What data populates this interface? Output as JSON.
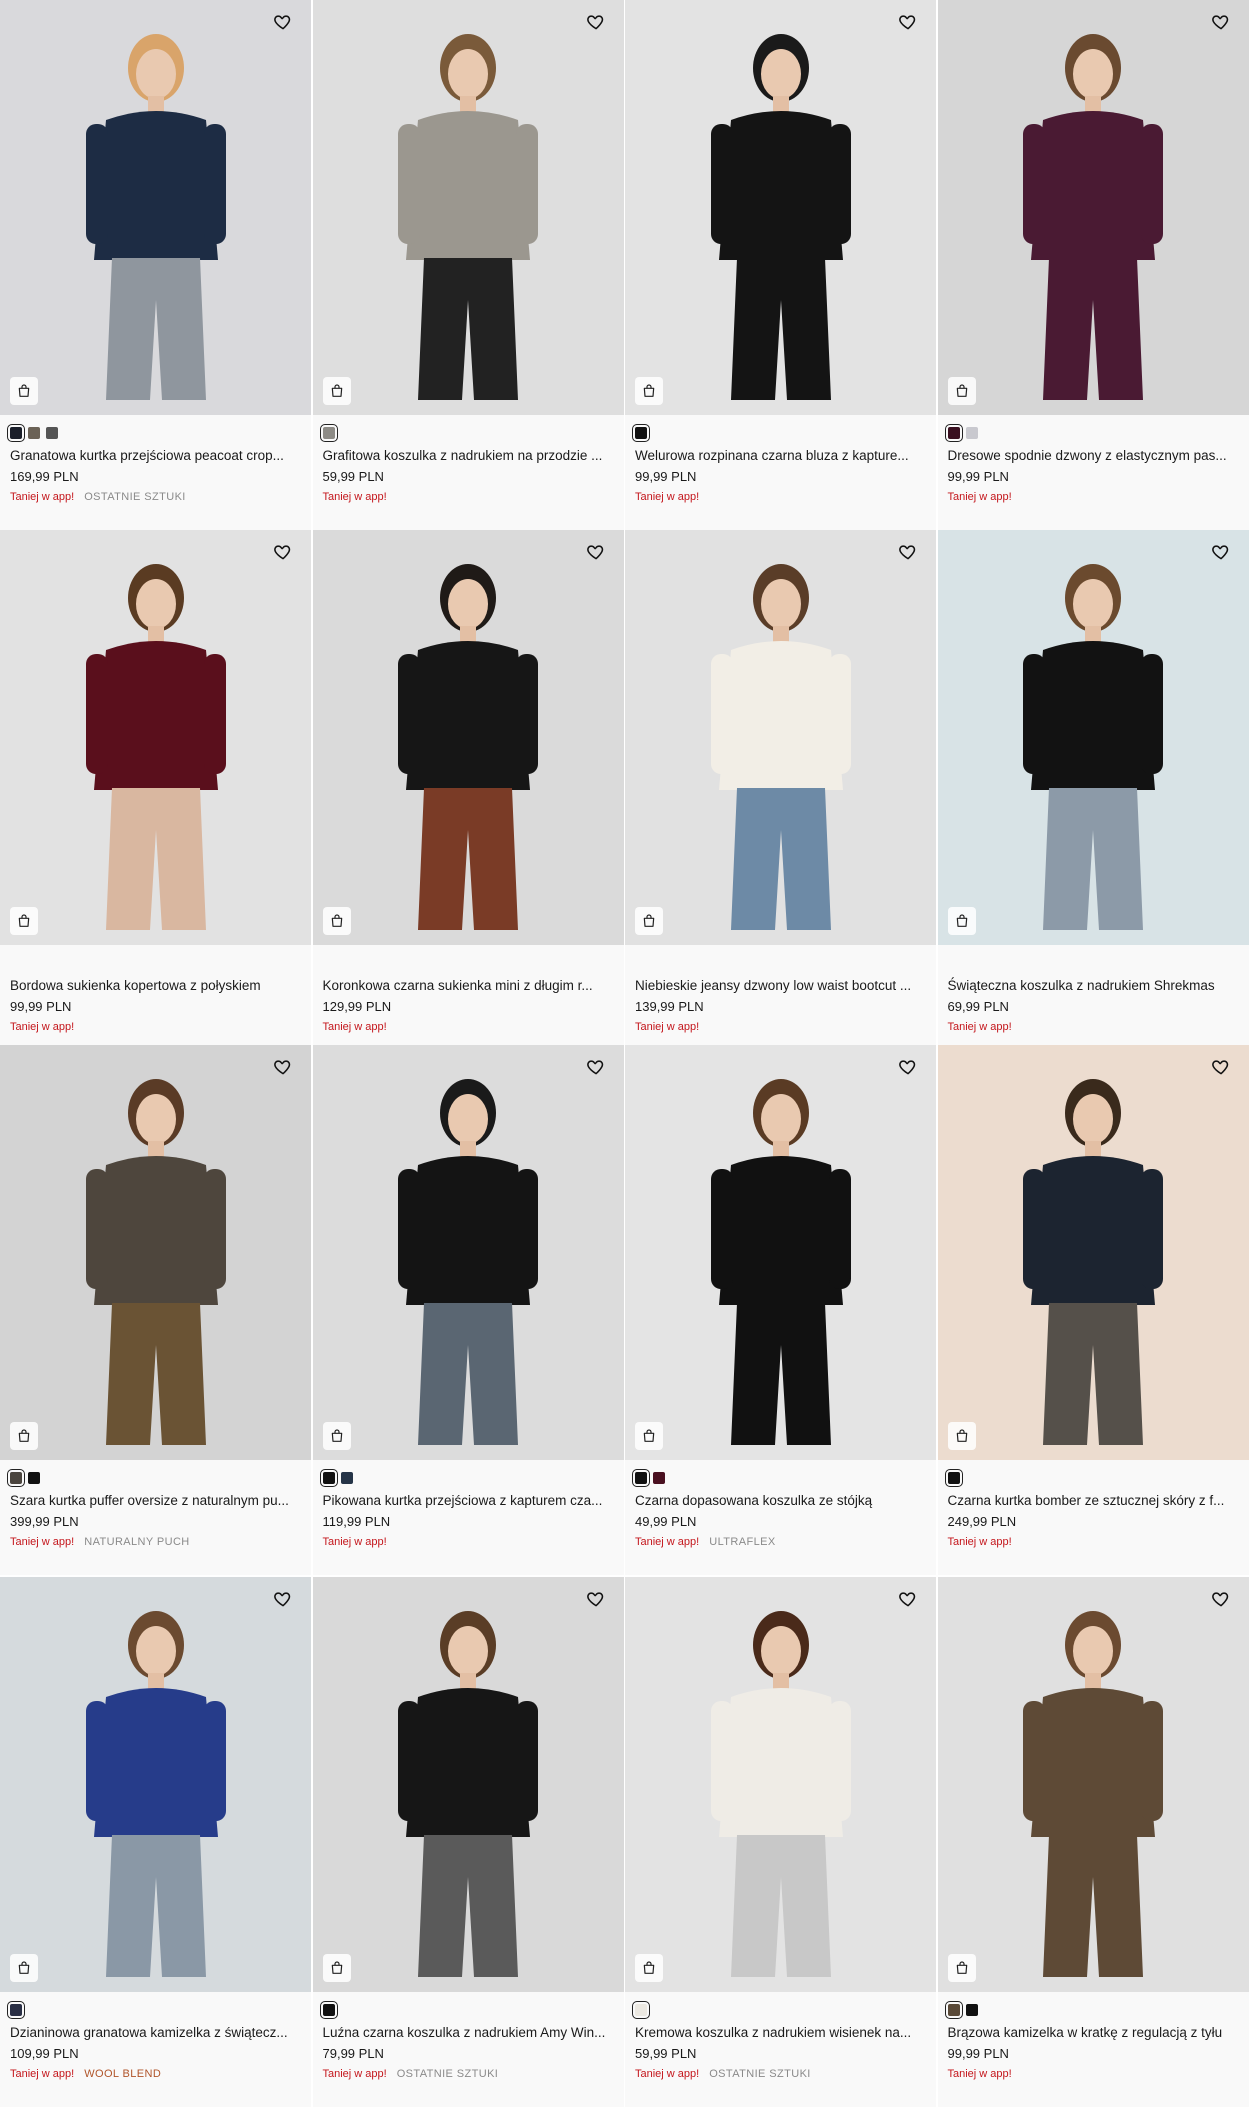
{
  "products": [
    {
      "name": "Granatowa kurtka przejściowa peacoat crop...",
      "price": "169,99 PLN",
      "promo": "Taniej w app!",
      "label": "OSTATNIE SZTUKI",
      "swatches": [
        "#1b1f2a",
        "#6b6256",
        "#555555"
      ],
      "bg": "#d9d9dc",
      "garment": "#1d2c44",
      "bottom": "#8f969e",
      "hair": "#d9a46a"
    },
    {
      "name": "Grafitowa koszulka z nadrukiem na przodzie ...",
      "price": "59,99 PLN",
      "promo": "Taniej w app!",
      "label": "",
      "swatches": [
        "#8d8b86"
      ],
      "bg": "#dedede",
      "garment": "#9b978f",
      "bottom": "#222222",
      "hair": "#7a5a3a"
    },
    {
      "name": "Welurowa rozpinana czarna bluza z kapture...",
      "price": "99,99 PLN",
      "promo": "Taniej w app!",
      "label": "",
      "swatches": [
        "#111111"
      ],
      "bg": "#e3e3e3",
      "garment": "#141414",
      "bottom": "#141414",
      "hair": "#1a1a1a"
    },
    {
      "name": "Dresowe spodnie dzwony z elastycznym pas...",
      "price": "99,99 PLN",
      "promo": "Taniej w app!",
      "label": "",
      "swatches": [
        "#3a1020",
        "#c9c9cf"
      ],
      "bg": "#d6d6d6",
      "garment": "#4a1a33",
      "bottom": "#4a1a33",
      "hair": "#6a4a30"
    },
    {
      "name": "Bordowa sukienka kopertowa z połyskiem",
      "price": "99,99 PLN",
      "promo": "Taniej w app!",
      "label": "",
      "swatches": [],
      "bg": "#e2e2e2",
      "garment": "#5a0f1c",
      "bottom": "#d9b7a0",
      "hair": "#5a3b22"
    },
    {
      "name": "Koronkowa czarna sukienka mini z długim r...",
      "price": "129,99 PLN",
      "promo": "Taniej w app!",
      "label": "",
      "swatches": [],
      "bg": "#dadada",
      "garment": "#161616",
      "bottom": "#7a3b26",
      "hair": "#1f1a17"
    },
    {
      "name": "Niebieskie jeansy dzwony low waist bootcut ...",
      "price": "139,99 PLN",
      "promo": "Taniej w app!",
      "label": "",
      "swatches": [],
      "bg": "#e1e1e1",
      "garment": "#f2eee6",
      "bottom": "#6d8aa6",
      "hair": "#5a3d28"
    },
    {
      "name": "Świąteczna koszulka z nadrukiem Shrekmas",
      "price": "69,99 PLN",
      "promo": "Taniej w app!",
      "label": "",
      "swatches": [],
      "bg": "#d8e3e6",
      "garment": "#121212",
      "bottom": "#8c9aa8",
      "hair": "#6b4a2e"
    },
    {
      "name": "Szara kurtka puffer oversize z naturalnym pu...",
      "price": "399,99 PLN",
      "promo": "Taniej w app!",
      "label": "NATURALNY PUCH",
      "swatches": [
        "#4b453e",
        "#111111"
      ],
      "bg": "#d3d3d3",
      "garment": "#4e463d",
      "bottom": "#6a5334",
      "hair": "#5a3b26"
    },
    {
      "name": "Pikowana kurtka przejściowa z kapturem cza...",
      "price": "119,99 PLN",
      "promo": "Taniej w app!",
      "label": "",
      "swatches": [
        "#111111",
        "#253447"
      ],
      "bg": "#dcdcdc",
      "garment": "#141414",
      "bottom": "#5a6672",
      "hair": "#1a1a1a"
    },
    {
      "name": "Czarna dopasowana koszulka ze stójką",
      "price": "49,99 PLN",
      "promo": "Taniej w app!",
      "label": "ULTRAFLEX",
      "swatches": [
        "#111111",
        "#4a1020"
      ],
      "bg": "#e4e4e4",
      "garment": "#111111",
      "bottom": "#111111",
      "hair": "#5a3b24"
    },
    {
      "name": "Czarna kurtka bomber ze sztucznej skóry z f...",
      "price": "249,99 PLN",
      "promo": "Taniej w app!",
      "label": "",
      "swatches": [
        "#111111"
      ],
      "bg": "#ecdccf",
      "garment": "#1c2430",
      "bottom": "#55504a",
      "hair": "#3a2a1c"
    },
    {
      "name": "Dzianinowa granatowa kamizelka z świątecz...",
      "price": "109,99 PLN",
      "promo": "Taniej w app!",
      "label": "WOOL BLEND",
      "swatches": [
        "#2a2f45"
      ],
      "bg": "#d5dadd",
      "garment": "#263c8a",
      "bottom": "#8a98a6",
      "hair": "#6b4a30"
    },
    {
      "name": "Luźna czarna koszulka z nadrukiem Amy Win...",
      "price": "79,99 PLN",
      "promo": "Taniej w app!",
      "label": "OSTATNIE SZTUKI",
      "swatches": [
        "#111111"
      ],
      "bg": "#d9d9d9",
      "garment": "#161616",
      "bottom": "#5a5a5a",
      "hair": "#5a3d26"
    },
    {
      "name": "Kremowa koszulka z nadrukiem wisienek na...",
      "price": "59,99 PLN",
      "promo": "Taniej w app!",
      "label": "OSTATNIE SZTUKI",
      "swatches": [
        "#ece9e2"
      ],
      "bg": "#e3e3e3",
      "garment": "#efece6",
      "bottom": "#c8c8c8",
      "hair": "#4a2a1a"
    },
    {
      "name": "Brązowa kamizelka w kratkę z regulacją z tyłu",
      "price": "99,99 PLN",
      "promo": "Taniej w app!",
      "label": "",
      "swatches": [
        "#5a4a38",
        "#111111"
      ],
      "bg": "#e0e0e0",
      "garment": "#5e4a36",
      "bottom": "#5e4a36",
      "hair": "#6b4a30"
    }
  ],
  "icons": {
    "favorite": "heart-icon",
    "quick_add": "shopping-bag-icon"
  }
}
